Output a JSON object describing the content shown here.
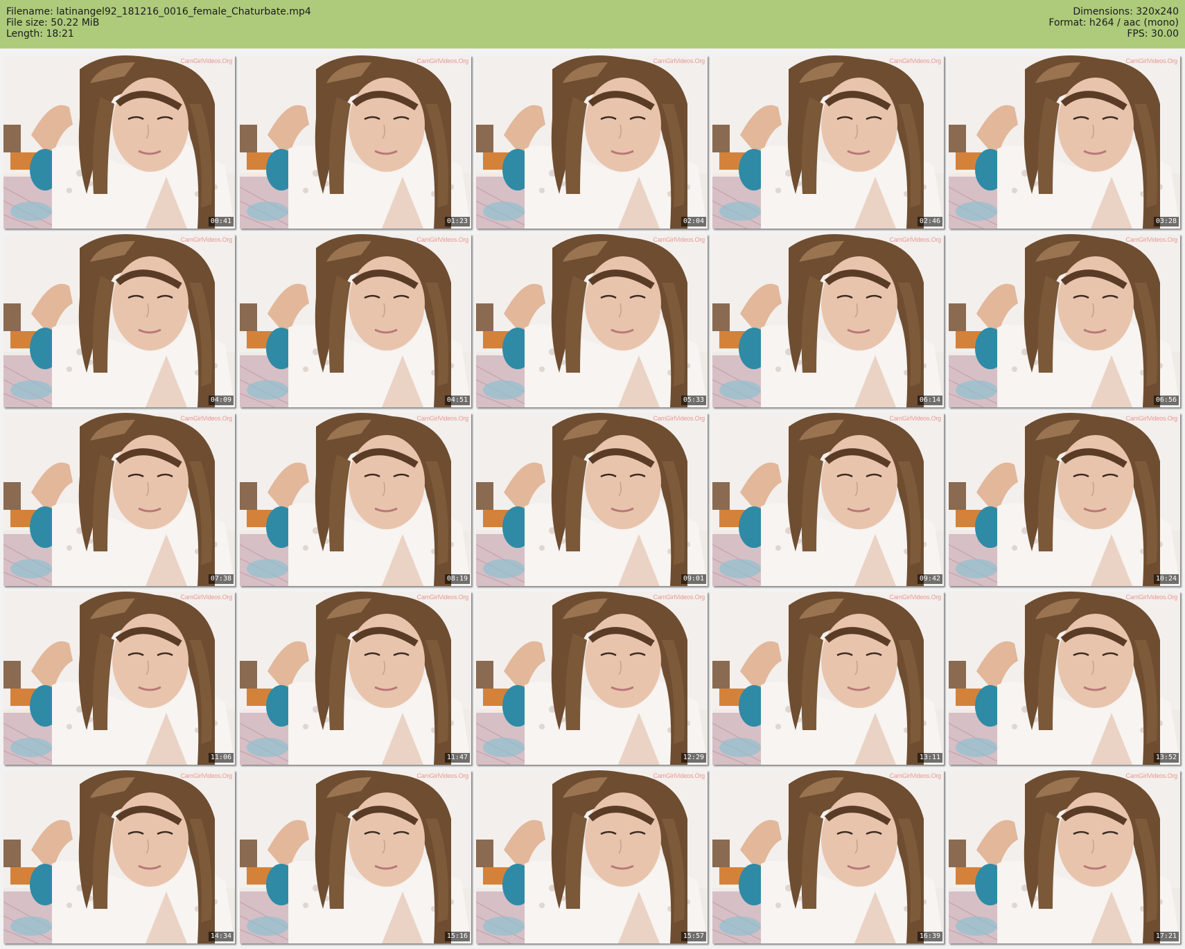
{
  "file_info": {
    "filename": "Filename: latinangel92_181216_0016_female_Chaturbate.mp4",
    "filesize": "File size: 50.22 MiB",
    "length": "Length: 18:21",
    "dimensions": "Dimensions: 320x240",
    "format": "Format: h264 / aac (mono)",
    "fps": "FPS: 30.00"
  },
  "colors": {
    "header_bg": "#aecb7c",
    "page_bg": "#f2f2f2"
  },
  "watermark_text": "CamGirlVideos.Org",
  "thumbnails": [
    {
      "time": "00:41"
    },
    {
      "time": "01:23"
    },
    {
      "time": "02:04"
    },
    {
      "time": "02:46"
    },
    {
      "time": "03:28"
    },
    {
      "time": "04:09"
    },
    {
      "time": "04:51"
    },
    {
      "time": "05:33"
    },
    {
      "time": "06:14"
    },
    {
      "time": "06:56"
    },
    {
      "time": "07:38"
    },
    {
      "time": "08:19"
    },
    {
      "time": "09:01"
    },
    {
      "time": "09:42"
    },
    {
      "time": "10:24"
    },
    {
      "time": "11:06"
    },
    {
      "time": "11:47"
    },
    {
      "time": "12:29"
    },
    {
      "time": "13:11"
    },
    {
      "time": "13:52"
    },
    {
      "time": "14:34"
    },
    {
      "time": "15:16"
    },
    {
      "time": "15:57"
    },
    {
      "time": "16:39"
    },
    {
      "time": "17:21"
    }
  ]
}
